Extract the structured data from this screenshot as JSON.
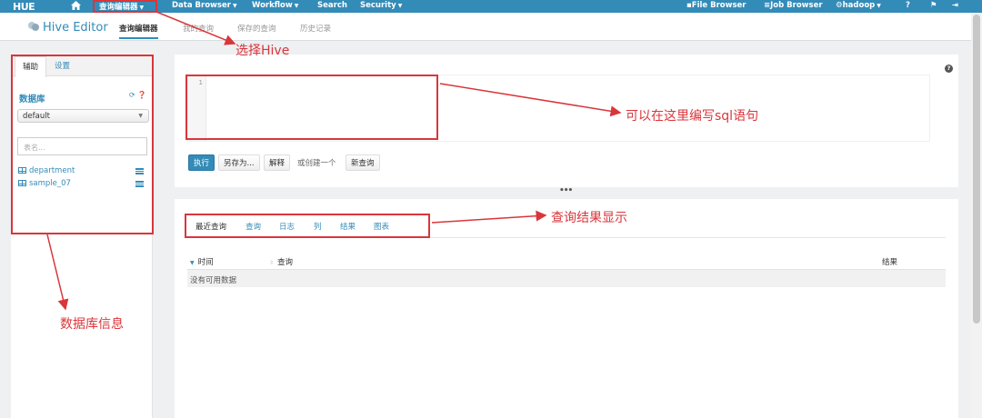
{
  "navbar": {
    "logo": "HUE",
    "items": [
      {
        "label": "查询编辑器",
        "dropdown": true
      },
      {
        "label": "Data Browser",
        "dropdown": true
      },
      {
        "label": "Workflow",
        "dropdown": true
      },
      {
        "label": "Search",
        "dropdown": false
      },
      {
        "label": "Security",
        "dropdown": true
      }
    ],
    "right_items": [
      {
        "label": "File Browser",
        "icon": "file-icon"
      },
      {
        "label": "Job Browser",
        "icon": "list-icon"
      },
      {
        "label": "hadoop",
        "icon": "gears-icon"
      }
    ]
  },
  "subheader": {
    "app_title": "Hive Editor",
    "tabs": [
      "查询编辑器",
      "我的查询",
      "保存的查询",
      "历史记录"
    ]
  },
  "left_panel": {
    "tabs": [
      "辅助",
      "设置"
    ],
    "db_title": "数据库",
    "db_selected": "default",
    "table_filter_placeholder": "表名...",
    "tables": [
      "department",
      "sample_07"
    ]
  },
  "editor": {
    "line_number": "1",
    "buttons": {
      "execute": "执行",
      "save_as": "另存为...",
      "explain": "解释"
    },
    "or_text": "或创建一个",
    "new_query": "新查询"
  },
  "results": {
    "tabs": [
      "最近查询",
      "查询",
      "日志",
      "列",
      "结果",
      "图表"
    ],
    "columns": [
      "时间",
      "查询",
      "结果"
    ],
    "empty_text": "没有可用数据"
  },
  "annotations": {
    "select_hive": "选择Hive",
    "write_sql": "可以在这里编写sql语句",
    "results_display": "查询结果显示",
    "db_info": "数据库信息"
  },
  "colors": {
    "brand": "#338bb8",
    "annotation": "#d9363b"
  }
}
